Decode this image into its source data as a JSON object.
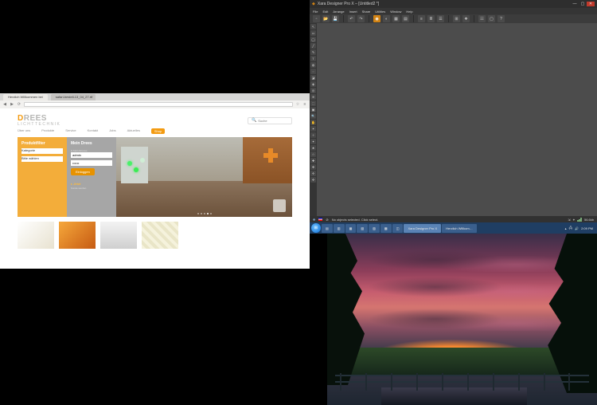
{
  "browser": {
    "tabs": [
      {
        "label": "Herzlich Willkommen bei"
      },
      {
        "label": "safari-bestell-13_04_27.rtf"
      }
    ],
    "page": {
      "logo_brand": "DREES",
      "logo_sub": "LICHTTECHNIK",
      "search_placeholder": "Suche",
      "nav": [
        "Über uns",
        "Produkte",
        "Service",
        "Kontakt",
        "Jobs",
        "Aktuelles",
        "Shop"
      ],
      "filter": {
        "title": "Produktfilter",
        "field1": "Kategorie",
        "field2": "Bitte wählen"
      },
      "login": {
        "title": "Mein Drees",
        "email_label": "E-Mail-Adresse",
        "email_value": "admin",
        "pw_value": "••••••",
        "login_btn": "Einloggen",
        "cta_head": "Jetzt",
        "cta_sub": "Kunde werden"
      }
    }
  },
  "app": {
    "title": "Xara Designer Pro X – [Untitled2 *]",
    "menus": [
      "File",
      "Edit",
      "Arrange",
      "Insert",
      "Share",
      "Utilities",
      "Window",
      "Help"
    ],
    "status_left": "No objects selected. Click select.",
    "status_right": "56.6kb"
  },
  "taskbar": {
    "items": [
      "",
      "",
      "",
      "",
      "",
      "",
      "",
      "Xara Designer Pro X",
      "Herzlich Willkom…"
    ],
    "time": "2:09 PM"
  },
  "colors": {
    "accent": "#f39b11",
    "app_bg": "#3f3f3f"
  }
}
